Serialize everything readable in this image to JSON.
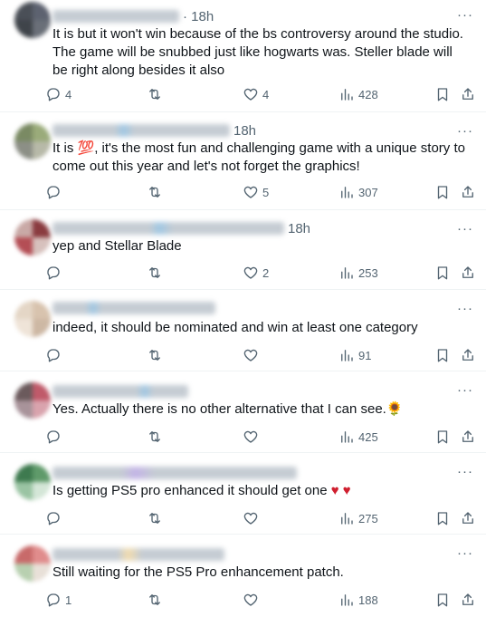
{
  "replies": [
    {
      "time": "· 18h",
      "text": "It is but it won't win because of the bs controversy around the studio. The game will be snubbed just like hogwarts was. Steller blade will be right along besides it also",
      "replies": "4",
      "reposts": "",
      "likes": "4",
      "views": "428",
      "avatar_colors": [
        "#4a4f57",
        "#5d6270",
        "#3f444a",
        "#6a6f78"
      ]
    },
    {
      "time": "18h",
      "text_before": "It is ",
      "emoji": "💯",
      "text_after": ", it's the most fun and challenging game with a unique story to come out this year and let's not forget the graphics!",
      "replies": "",
      "reposts": "",
      "likes": "5",
      "views": "307",
      "avatar_colors": [
        "#7a8a63",
        "#9aab7a",
        "#8c8f86",
        "#b7b9a8"
      ]
    },
    {
      "time": "18h",
      "text": "yep and Stellar Blade",
      "replies": "",
      "reposts": "",
      "likes": "2",
      "views": "253",
      "avatar_colors": [
        "#c9a9a6",
        "#8a3b3f",
        "#b44e55",
        "#d7c1bd"
      ]
    },
    {
      "time": "",
      "text": "indeed, it should be nominated and win at least one category",
      "replies": "",
      "reposts": "",
      "likes": "",
      "views": "91",
      "avatar_colors": [
        "#e4d6c6",
        "#d8c3ae",
        "#efe4d8",
        "#cdb8a4"
      ]
    },
    {
      "time": "",
      "text": "Yes. Actually there is no other alternative that I can see.",
      "emoji": "🌻",
      "replies": "",
      "reposts": "",
      "likes": "",
      "views": "425",
      "avatar_colors": [
        "#6b5a5c",
        "#c05a6a",
        "#a8939a",
        "#d9a3ad"
      ]
    },
    {
      "time": "",
      "text": "Is getting PS5 pro enhanced it should get one",
      "hearts": "♥ ♥",
      "replies": "",
      "reposts": "",
      "likes": "",
      "views": "275",
      "avatar_colors": [
        "#3e7a4f",
        "#5f9a6a",
        "#9ac4a3",
        "#d4e6d7"
      ]
    },
    {
      "time": "",
      "text": "Still waiting for the PS5 Pro enhancement patch.",
      "replies": "1",
      "reposts": "",
      "likes": "",
      "views": "188",
      "avatar_colors": [
        "#c86a6a",
        "#e08c8c",
        "#b8d0b0",
        "#e8e0d8"
      ]
    }
  ],
  "more_label": "···"
}
